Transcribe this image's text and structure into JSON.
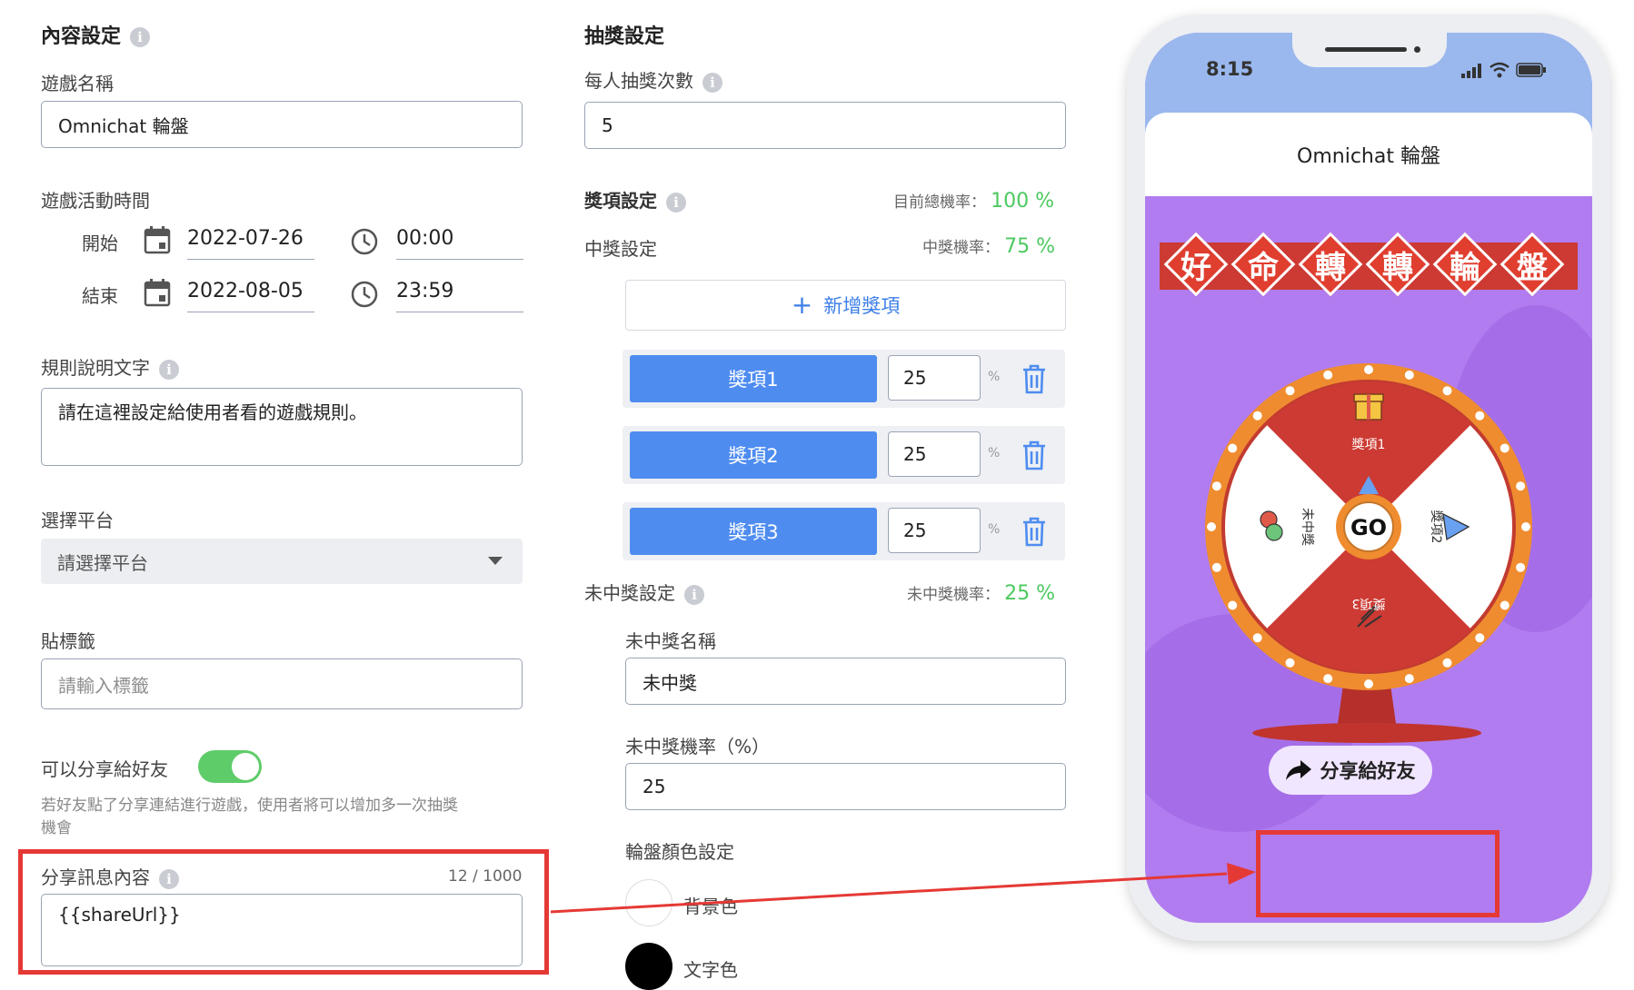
{
  "content": {
    "section_title": "內容設定",
    "game_name_label": "遊戲名稱",
    "game_name_value": "Omnichat 輪盤",
    "time_label": "遊戲活動時間",
    "start_label": "開始",
    "start_date": "2022-07-26",
    "start_time": "00:00",
    "end_label": "結束",
    "end_date": "2022-08-05",
    "end_time": "23:59",
    "rules_label": "規則說明文字",
    "rules_value": "請在這裡設定給使用者看的遊戲規則。",
    "platform_label": "選擇平台",
    "platform_placeholder": "請選擇平台",
    "tag_label": "貼標籤",
    "tag_placeholder": "請輸入標籤",
    "share_toggle_label": "可以分享給好友",
    "share_toggle_on": true,
    "share_hint_line1": "若好友點了分享連結進行遊戲，使用者將可以增加多一次抽獎",
    "share_hint_line2": "機會",
    "share_msg_label": "分享訊息內容",
    "share_msg_count": "12 / 1000",
    "share_msg_value": "{{shareUrl}}"
  },
  "draw": {
    "section_title": "抽獎設定",
    "times_label": "每人抽獎次數",
    "times_value": "5",
    "prize_settings_label": "獎項設定",
    "total_rate_label": "目前總機率：",
    "total_rate_value": "100 %",
    "win_settings_label": "中獎設定",
    "win_rate_label": "中獎機率：",
    "win_rate_value": "75 %",
    "add_prize_label": "新增獎項",
    "prizes": [
      {
        "name": "獎項1",
        "value": "25",
        "unit": "%"
      },
      {
        "name": "獎項2",
        "value": "25",
        "unit": "%"
      },
      {
        "name": "獎項3",
        "value": "25",
        "unit": "%"
      }
    ],
    "lose_settings_label": "未中獎設定",
    "lose_rate_label": "未中獎機率：",
    "lose_rate_value": "25 %",
    "lose_name_label": "未中獎名稱",
    "lose_name_value": "未中獎",
    "lose_rate_input_label": "未中獎機率（%）",
    "lose_rate_input_value": "25",
    "wheel_color_label": "輪盤顏色設定",
    "bg_color_label": "背景色",
    "text_color_label": "文字色"
  },
  "phone": {
    "time": "8:15",
    "header_title": "Omnichat 輪盤",
    "banner_chars": [
      "好",
      "命",
      "轉",
      "轉",
      "輪",
      "盤"
    ],
    "wheel_labels": {
      "top": "獎項1",
      "right": "獎項2",
      "bottom": "獎項3",
      "left": "未中獎"
    },
    "go_label": "GO",
    "share_button": "分享給好友"
  },
  "colors": {
    "primary": "#4e8cf0",
    "success": "#4cc95f",
    "highlight": "#e53935",
    "phone_bg": "#b07cf0",
    "wheel_red": "#cc3a33",
    "wheel_orange": "#ef8c2f"
  },
  "icons": [
    "info-icon",
    "calendar-icon",
    "clock-icon",
    "dropdown-caret-icon",
    "plus-icon",
    "trash-icon",
    "share-arrow-icon",
    "signal-icon",
    "wifi-icon",
    "battery-icon"
  ]
}
